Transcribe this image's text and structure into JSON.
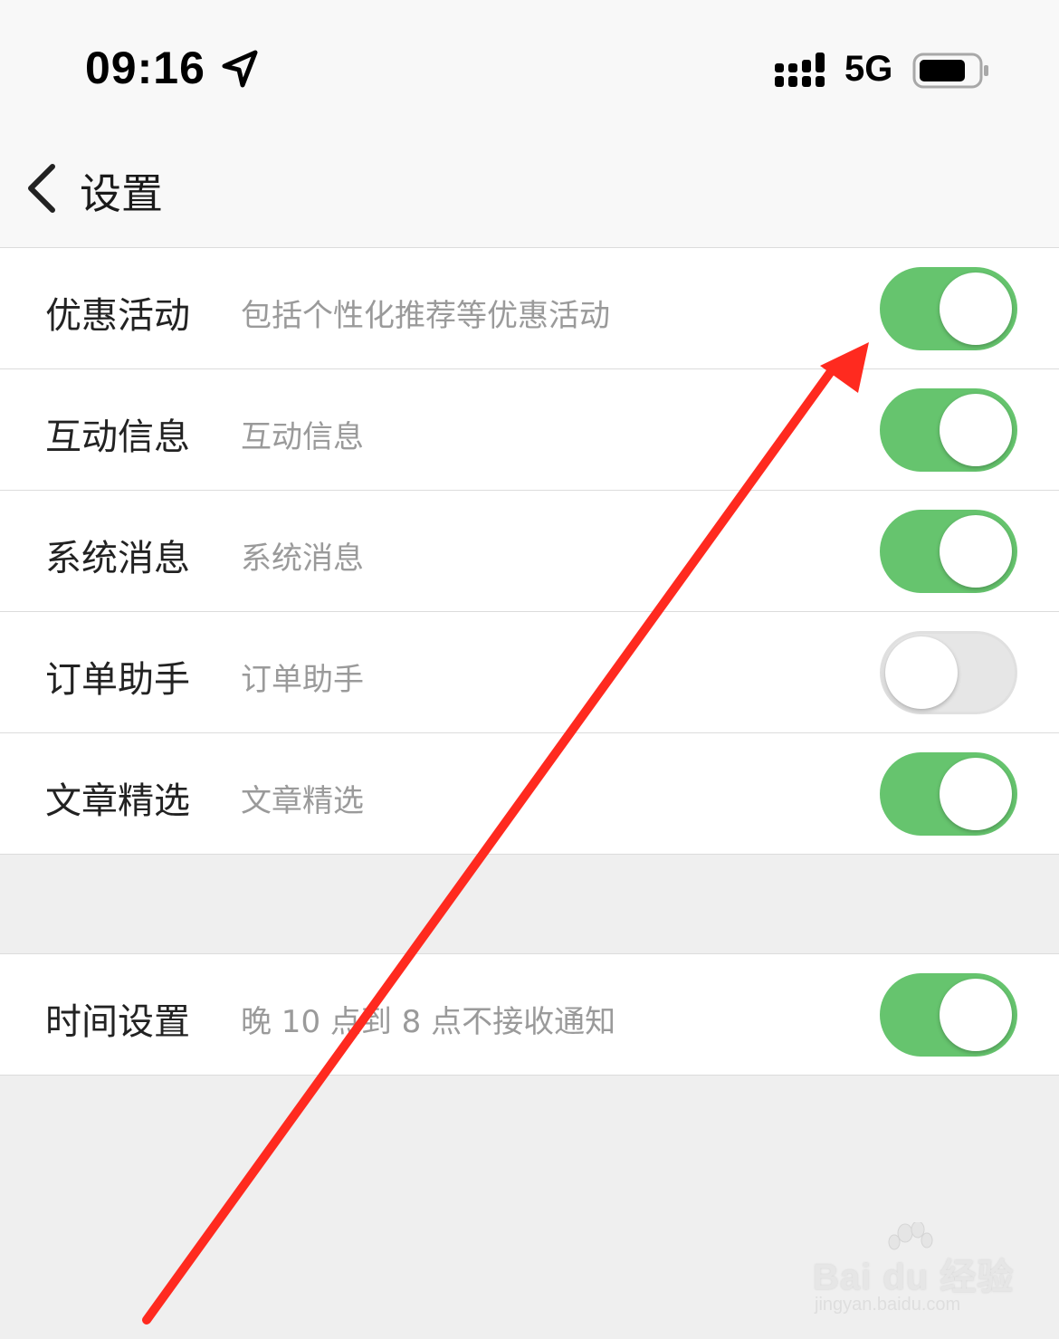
{
  "status_bar": {
    "time": "09:16",
    "network": "5G"
  },
  "nav": {
    "title": "设置"
  },
  "settings": [
    {
      "title": "优惠活动",
      "description": "包括个性化推荐等优惠活动",
      "enabled": true
    },
    {
      "title": "互动信息",
      "description": "互动信息",
      "enabled": true
    },
    {
      "title": "系统消息",
      "description": "系统消息",
      "enabled": true
    },
    {
      "title": "订单助手",
      "description": "订单助手",
      "enabled": false
    },
    {
      "title": "文章精选",
      "description": "文章精选",
      "enabled": true
    }
  ],
  "time_setting": {
    "title": "时间设置",
    "description": "晚 10 点到 8 点不接收通知",
    "enabled": true
  },
  "colors": {
    "switch_on": "#66c46e",
    "switch_off": "#e6e6e6",
    "annotation_arrow": "#ff2a1f"
  },
  "watermark": {
    "brand": "Bai du 经验",
    "site": "jingyan.baidu.com"
  }
}
